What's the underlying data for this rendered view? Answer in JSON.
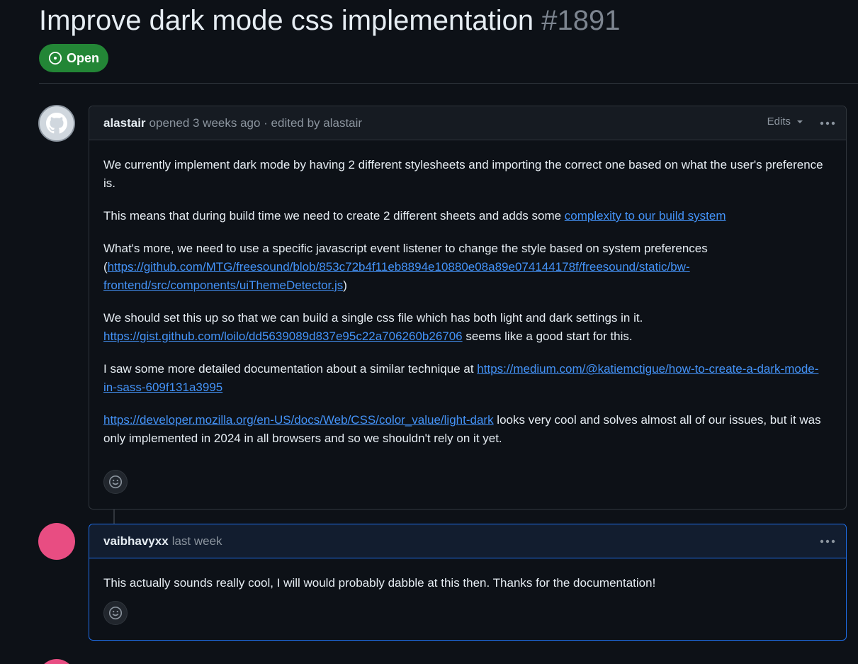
{
  "issue": {
    "title": "Improve dark mode css implementation",
    "number": "#1891",
    "state": "Open"
  },
  "colors": {
    "background": "#0d1117",
    "open_badge": "#238636",
    "link": "#4493f8",
    "avatar_pink": "#e84d82"
  },
  "comments": [
    {
      "author": "alastair",
      "meta": "opened 3 weeks ago · edited by alastair",
      "edits_label": "Edits",
      "avatar_icon": "github-octocat-icon",
      "paragraphs": {
        "p1": "We currently implement dark mode by having 2 different stylesheets and importing the correct one based on what the user's preference is.",
        "p2_text": "This means that during build time we need to create 2 different sheets and adds some ",
        "p2_link": "complexity to our build system",
        "p3_text": "What's more, we need to use a specific javascript event listener to change the style based on system preferences (",
        "p3_link": "https://github.com/MTG/freesound/blob/853c72b4f11eb8894e10880e08a89e074144178f/freesound/static/bw-frontend/src/components/uiThemeDetector.js",
        "p3_end": ")",
        "p4_text": "We should set this up so that we can build a single css file which has both light and dark settings in it.",
        "p4_link": "https://gist.github.com/loilo/dd5639089d837e95c22a706260b26706",
        "p4_end": " seems like a good start for this.",
        "p5_text": "I saw some more detailed documentation about a similar technique at ",
        "p5_link": "https://medium.com/@katiemctigue/how-to-create-a-dark-mode-in-sass-609f131a3995",
        "p6_link": "https://developer.mozilla.org/en-US/docs/Web/CSS/color_value/light-dark",
        "p6_text": " looks very cool and solves almost all of our issues, but it was only implemented in 2024 in all browsers and so we shouldn't rely on it yet."
      }
    },
    {
      "author": "vaibhavyxx",
      "meta": "last week",
      "body": "This actually sounds really cool, I will would probably dabble at this then. Thanks for the documentation!"
    }
  ],
  "icons": {
    "state": "issue-open-icon",
    "edits": "triangle-down-icon",
    "more": "kebab-horizontal-icon",
    "reaction": "smiley-icon"
  }
}
